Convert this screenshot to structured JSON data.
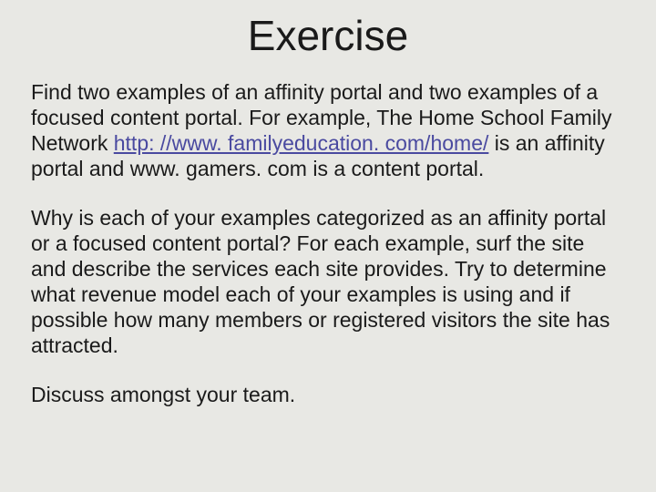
{
  "title": "Exercise",
  "p1_a": "Find two examples of an affinity portal and two examples of a focused content portal. For example, The Home School Family Network ",
  "p1_link": "http: //www. familyeducation. com/home/",
  "p1_b": " is an affinity portal and www. gamers. com is a content portal.",
  "p2": "Why is each of your examples categorized as an affinity portal or a focused content portal? For each example, surf the site and describe the services each site provides. Try to determine what revenue model each of your examples is using and if possible how many members or registered visitors the site has attracted.",
  "p3": "Discuss amongst your team."
}
